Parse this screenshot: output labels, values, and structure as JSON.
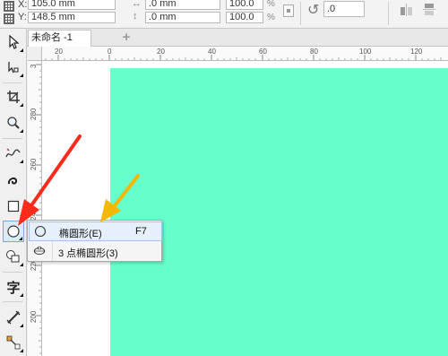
{
  "property_bar": {
    "x_label": "X:",
    "x_value": "105.0 mm",
    "y_label": "Y:",
    "y_value": "148.5 mm",
    "width_value": ".0 mm",
    "height_value": ".0 mm",
    "scale_w": "100.0",
    "scale_h": "100.0",
    "percent": "%",
    "rotation_value": ".0"
  },
  "document_tab": {
    "label": "未命名 -1",
    "add_symbol": "+"
  },
  "rulers": {
    "top_ticks": [
      "20",
      "0",
      "20",
      "40",
      "60",
      "80",
      "100",
      "120"
    ],
    "left_ticks": [
      "3",
      "280",
      "260",
      "240",
      "220",
      "200"
    ]
  },
  "flyout_menu": {
    "items": [
      {
        "label": "椭圆形(E)",
        "shortcut": "F7"
      },
      {
        "label": "3 点椭圆形(3)",
        "shortcut": ""
      }
    ]
  },
  "toolbox": {
    "text_tool_glyph": "字"
  },
  "colors": {
    "page_fill": "#66ffcc",
    "menu_highlight": "#e5f0fb",
    "annotation_red_arrow": "#ff2a1a",
    "annotation_yellow_arrow": "#f5b800"
  }
}
